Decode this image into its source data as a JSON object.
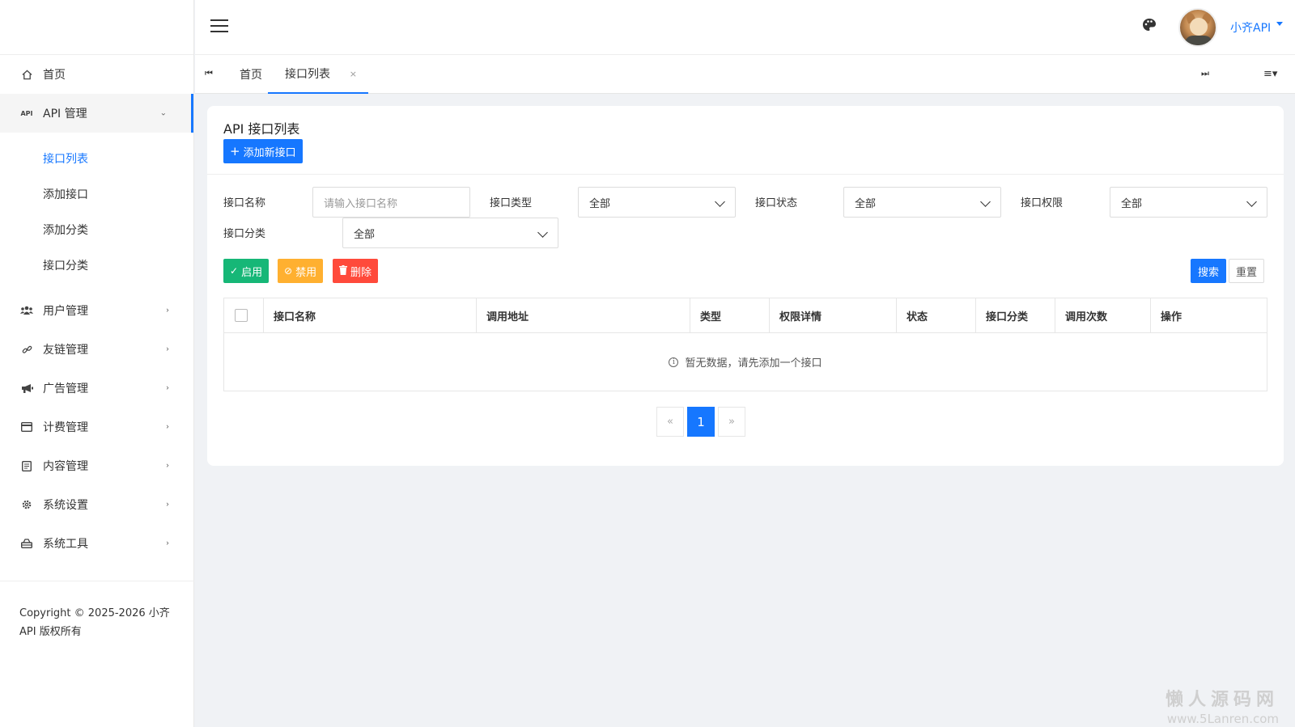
{
  "sidebar": {
    "menu": [
      {
        "label": "首页",
        "icon": "home-icon"
      },
      {
        "label": "API 管理",
        "icon": "api-icon"
      },
      {
        "label": "用户管理",
        "icon": "users-icon"
      },
      {
        "label": "友链管理",
        "icon": "link-icon"
      },
      {
        "label": "广告管理",
        "icon": "megaphone-icon"
      },
      {
        "label": "计费管理",
        "icon": "credit-card-icon"
      },
      {
        "label": "内容管理",
        "icon": "document-icon"
      },
      {
        "label": "系统设置",
        "icon": "gear-icon"
      },
      {
        "label": "系统工具",
        "icon": "toolbox-icon"
      }
    ],
    "api_submenu": [
      "接口列表",
      "添加接口",
      "添加分类",
      "接口分类"
    ],
    "api_icon_text": "API",
    "copyright_line1": "Copyright © 2025-2026 小齐",
    "copyright_line2": "API 版权所有"
  },
  "header": {
    "username": "小齐API"
  },
  "tabs": {
    "items": [
      "首页",
      "接口列表"
    ],
    "close_glyph": "×",
    "prev_glyph": "⏮",
    "next_glyph": "⏭",
    "menu_glyph": "≡▾"
  },
  "card": {
    "title": "API 接口列表",
    "add_button": "添加新接口"
  },
  "filters": {
    "name_label": "接口名称",
    "name_placeholder": "请输入接口名称",
    "type_label": "接口类型",
    "type_value": "全部",
    "status_label": "接口状态",
    "status_value": "全部",
    "permission_label": "接口权限",
    "permission_value": "全部",
    "category_label": "接口分类",
    "category_value": "全部"
  },
  "actions": {
    "enable": "启用",
    "disable": "禁用",
    "delete": "删除",
    "search": "搜索",
    "reset": "重置"
  },
  "table": {
    "columns": [
      "接口名称",
      "调用地址",
      "类型",
      "权限详情",
      "状态",
      "接口分类",
      "调用次数",
      "操作"
    ],
    "empty_text": "暂无数据，请先添加一个接口"
  },
  "pagination": {
    "prev": "«",
    "current": "1",
    "next": "»"
  },
  "watermark": {
    "line1": "懒人源码网",
    "line2": "www.5Lanren.com"
  },
  "colors": {
    "primary": "#1677ff",
    "enable": "#16b777",
    "disable": "#ffb030",
    "delete": "#ff4a3b"
  }
}
